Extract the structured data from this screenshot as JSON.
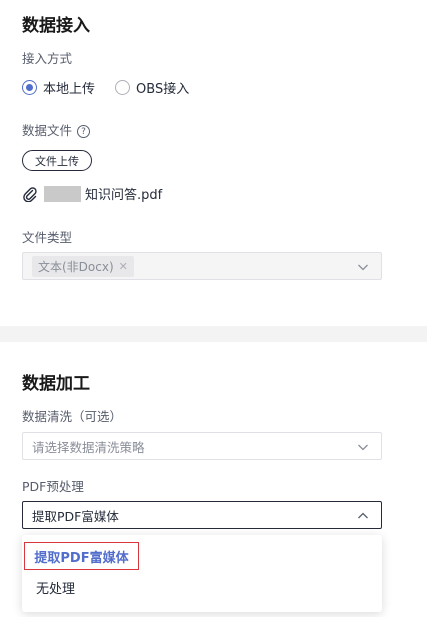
{
  "data_access": {
    "title": "数据接入",
    "access_method_label": "接入方式",
    "access_options": [
      {
        "label": "本地上传",
        "checked": true
      },
      {
        "label": "OBS接入",
        "checked": false
      }
    ],
    "data_file_label": "数据文件",
    "help_glyph": "?",
    "upload_button": "文件上传",
    "file_name": "知识问答.pdf",
    "file_type_label": "文件类型",
    "file_type_tag": "文本(非Docx)",
    "tag_remove_glyph": "✕"
  },
  "data_processing": {
    "title": "数据加工",
    "cleaning_label": "数据清洗（可选）",
    "cleaning_placeholder": "请选择数据清洗策略",
    "pdf_label": "PDF预处理",
    "pdf_selected": "提取PDF富媒体",
    "pdf_options": [
      "提取PDF富媒体",
      "无处理"
    ]
  },
  "colors": {
    "accent": "#526ecc",
    "highlight_border": "#d9363e"
  }
}
